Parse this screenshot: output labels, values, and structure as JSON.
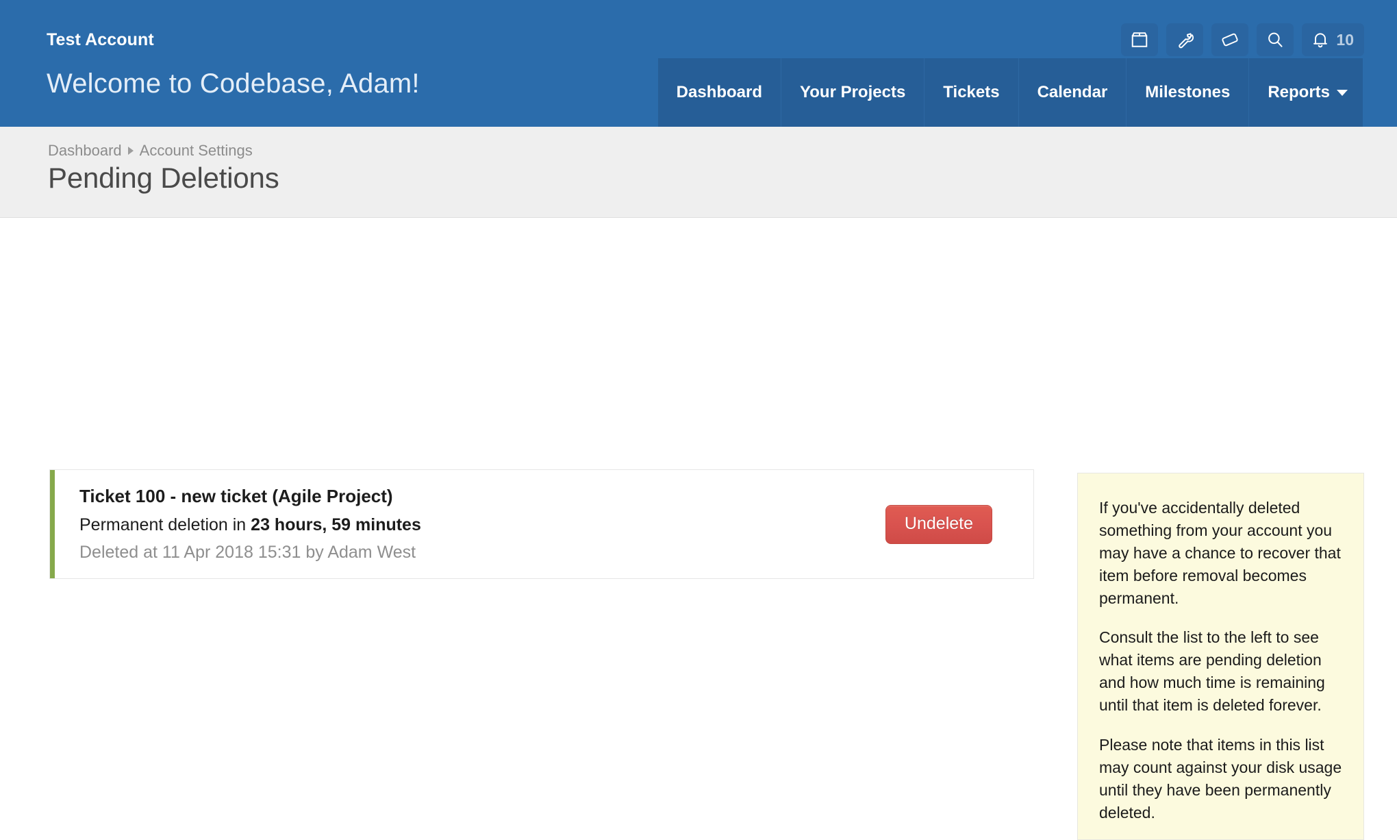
{
  "header": {
    "account_name": "Test Account",
    "welcome": "Welcome to Codebase, Adam!",
    "brand_blue": "#2b6cab",
    "nav_blue": "#265e97",
    "icons": [
      {
        "name": "box-icon",
        "label": "Repositories"
      },
      {
        "name": "wrench-icon",
        "label": "Settings"
      },
      {
        "name": "ticket-icon",
        "label": "Tickets"
      },
      {
        "name": "search-icon",
        "label": "Search"
      }
    ],
    "notifications": {
      "icon": "bell-icon",
      "count": "10"
    }
  },
  "nav": {
    "items": [
      {
        "label": "Dashboard",
        "caret": false
      },
      {
        "label": "Your Projects",
        "caret": false
      },
      {
        "label": "Tickets",
        "caret": false
      },
      {
        "label": "Calendar",
        "caret": false
      },
      {
        "label": "Milestones",
        "caret": false
      },
      {
        "label": "Reports",
        "caret": true
      }
    ]
  },
  "breadcrumb": {
    "root": "Dashboard",
    "current": "Account Settings"
  },
  "page": {
    "title": "Pending Deletions"
  },
  "deletions": [
    {
      "title": "Ticket 100 - new ticket (Agile Project)",
      "countdown_prefix": "Permanent deletion in ",
      "countdown_value": "23 hours, 59 minutes",
      "meta": "Deleted at 11 Apr 2018 15:31 by Adam West",
      "action_label": "Undelete",
      "accent_color": "#86a94b"
    }
  ],
  "info_panel": {
    "background": "#fcfade",
    "paragraphs": [
      "If you've accidentally deleted something from your account you may have a chance to recover that item before removal becomes permanent.",
      "Consult the list to the left to see what items are pending deletion and how much time is remaining until that item is deleted forever.",
      "Please note that items in this list may count against your disk usage until they have been permanently deleted."
    ]
  }
}
